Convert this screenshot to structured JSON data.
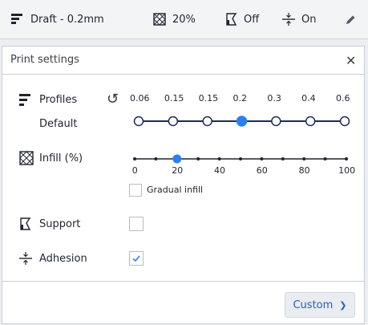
{
  "topbar": {
    "profile_label": "Draft - 0.2mm",
    "infill_label": "20%",
    "support_label": "Off",
    "adhesion_label": "On",
    "icons": [
      "profile-icon",
      "infill-icon",
      "support-icon",
      "adhesion-icon",
      "pencil-icon"
    ]
  },
  "panel": {
    "title": "Print settings",
    "close_glyph": "✕",
    "profiles": {
      "label": "Profiles",
      "sub_label": "Default",
      "reset_glyph": "↺",
      "values": [
        "0.06",
        "0.15",
        "0.15",
        "0.2",
        "0.3",
        "0.4",
        "0.6"
      ],
      "selected_index": 3
    },
    "infill": {
      "label": "Infill (%)",
      "ticks": [
        "0",
        "20",
        "40",
        "60",
        "80",
        "100"
      ],
      "value": 20,
      "gradual_label": "Gradual infill",
      "gradual_checked": false
    },
    "support": {
      "label": "Support",
      "checked": false
    },
    "adhesion": {
      "label": "Adhesion",
      "checked": true
    },
    "custom_button": "Custom",
    "chevron_glyph": "❯"
  },
  "colors": {
    "accent": "#2d7ff0",
    "slider_dark": "#1e2a5a",
    "text": "#1f2430"
  }
}
